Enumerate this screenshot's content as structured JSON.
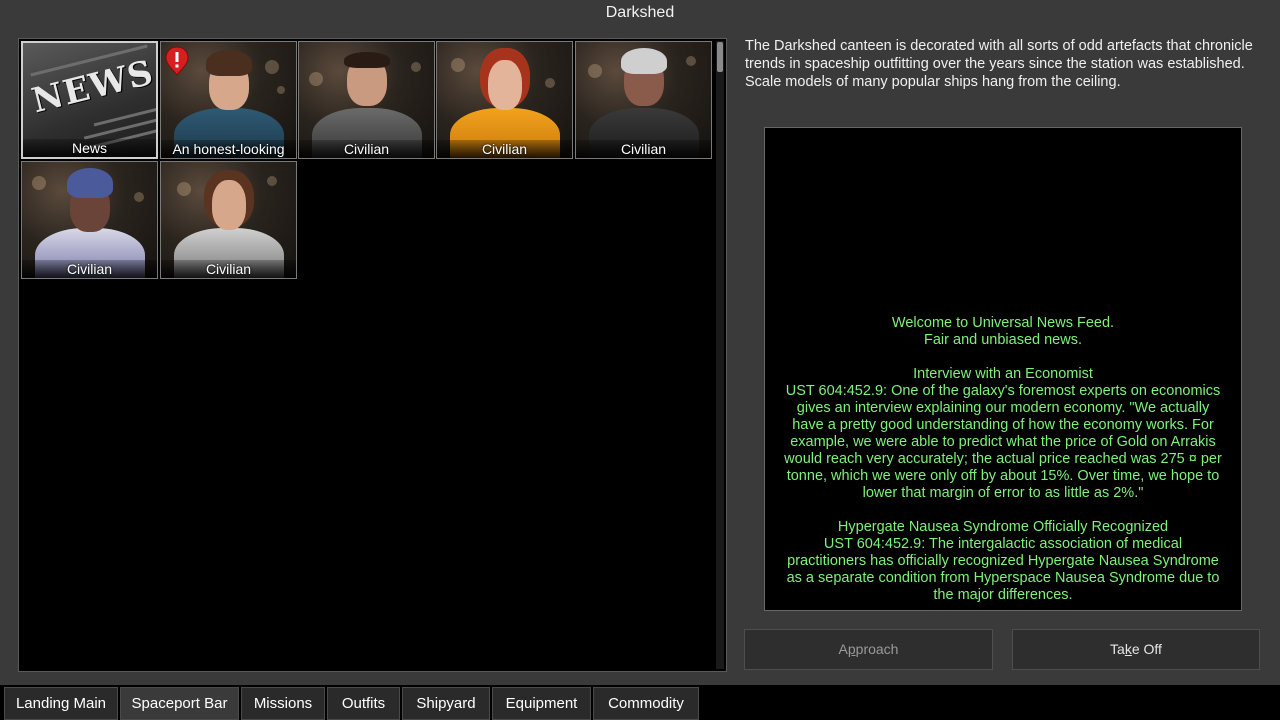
{
  "window": {
    "title": "Darkshed"
  },
  "npcs": [
    {
      "label": "News",
      "type": "news",
      "art_text": "NEWS"
    },
    {
      "label": "An honest-looking",
      "type": "person",
      "alert": true
    },
    {
      "label": "Civilian",
      "type": "person"
    },
    {
      "label": "Civilian",
      "type": "person"
    },
    {
      "label": "Civilian",
      "type": "person"
    },
    {
      "label": "Civilian",
      "type": "person"
    },
    {
      "label": "Civilian",
      "type": "person"
    }
  ],
  "description": "The Darkshed canteen is decorated with all sorts of odd artefacts that chronicle trends in spaceship outfitting over the years since the station was established. Scale models of many popular ships hang from the ceiling.",
  "news": {
    "header1": "Welcome to Universal News Feed.",
    "header2": "Fair and unbiased news.",
    "article1_title": "Interview with an Economist",
    "article1_body": "UST 604:452.9: One of the galaxy's foremost experts on economics gives an interview explaining our modern economy. \"We actually have a pretty good understanding of how the economy works. For example, we were able to predict what the price of Gold on Arrakis would reach very accurately; the actual price reached was 275 ¤ per tonne, which we were only off by about 15%. Over time, we hope to lower that margin of error to as little as 2%.\"",
    "article2_title": "Hypergate Nausea Syndrome Officially Recognized",
    "article2_body": "UST 604:452.9: The intergalactic association of medical practitioners has officially recognized Hypergate Nausea Syndrome as a separate condition from Hyperspace Nausea Syndrome due to the major differences."
  },
  "buttons": {
    "approach_first": "A",
    "approach_underlined": "p",
    "approach_rest": "proach",
    "takeoff_first": "Ta",
    "takeoff_underlined": "k",
    "takeoff_rest": "e Off"
  },
  "tabs": [
    "Landing Main",
    "Spaceport Bar",
    "Missions",
    "Outfits",
    "Shipyard",
    "Equipment",
    "Commodity"
  ],
  "active_tab": "Spaceport Bar",
  "colors": {
    "news_text": "#7ff07a",
    "background": "#3a3a3a",
    "alert": "#d81f1f"
  }
}
